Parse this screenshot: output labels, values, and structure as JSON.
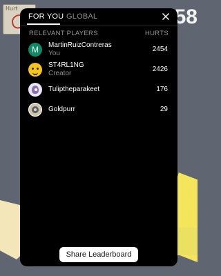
{
  "background": {
    "thumb_label": "Hurt",
    "counter": "58"
  },
  "tabs": [
    {
      "label": "FOR YOU",
      "active": true
    },
    {
      "label": "GLOBAL",
      "active": false
    }
  ],
  "close_icon": "close-icon",
  "columns": {
    "players": "RELEVANT PLAYERS",
    "hurts": "HURTS"
  },
  "players": [
    {
      "name": "MartinRuizContreras",
      "subtitle": "You",
      "score": "2454",
      "avatar": "letter-m",
      "avatar_letter": "M",
      "avatar_color": "#0d8a66"
    },
    {
      "name": "ST4RL1NG",
      "subtitle": "Creator",
      "score": "2426",
      "avatar": "emoji-face",
      "avatar_color": "#f5c518"
    },
    {
      "name": "Tuliptheparakeet",
      "subtitle": "",
      "score": "176",
      "avatar": "bird-photo"
    },
    {
      "name": "Goldpurr",
      "subtitle": "",
      "score": "29",
      "avatar": "cat-photo"
    }
  ],
  "share_button": "Share Leaderboard",
  "colors": {
    "panel_bg": "#000000",
    "muted_text": "#8e8e8e",
    "button_bg": "#ffffff"
  }
}
